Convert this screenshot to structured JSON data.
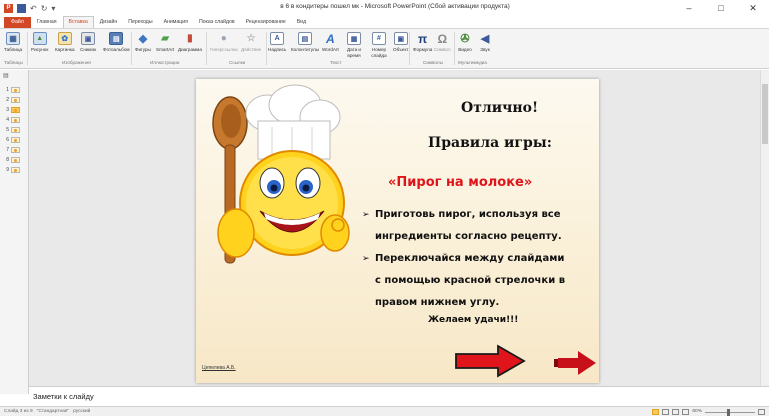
{
  "window": {
    "title": "в 6 в кондитеры пошел  мк - Microsoft PowerPoint (Сбой активации продукта)",
    "controls": [
      "–",
      "□",
      "✕"
    ]
  },
  "quick_access": {
    "app_letter": "P"
  },
  "tabs": [
    {
      "label": "Файл",
      "active": false,
      "file": true
    },
    {
      "label": "Главная",
      "active": false
    },
    {
      "label": "Вставка",
      "active": true
    },
    {
      "label": "Дизайн",
      "active": false
    },
    {
      "label": "Переходы",
      "active": false
    },
    {
      "label": "Анимация",
      "active": false
    },
    {
      "label": "Показ слайдов",
      "active": false
    },
    {
      "label": "Рецензирование",
      "active": false
    },
    {
      "label": "Вид",
      "active": false
    }
  ],
  "ribbon": {
    "buttons": {
      "table": "Таблица",
      "picture": "Рисунок",
      "clipart": "Картинка",
      "screenshot": "Снимок",
      "album": "Фотоальбом",
      "shapes": "Фигуры",
      "smartart": "SmartArt",
      "chart": "Диаграмма",
      "hyperlink": "Гиперссылка",
      "action": "Действие",
      "textbox": "Надпись",
      "header_footer": "Колонтитулы",
      "wordart": "WordArt",
      "datetime": "Дата и время",
      "slide_number": "Номер слайда",
      "object": "Объект",
      "equation": "Формула",
      "symbol": "Символ",
      "video": "Видео",
      "audio": "Звук"
    },
    "groups": {
      "tables": "Таблицы",
      "images": "Изображения",
      "illustrations": "Иллюстрации",
      "links": "Ссылки",
      "text": "Текст",
      "symbols": "Символы",
      "media": "Мультимедиа"
    }
  },
  "thumbnails": [
    {
      "num": "1",
      "selected": false
    },
    {
      "num": "2",
      "selected": false
    },
    {
      "num": "3",
      "selected": true
    },
    {
      "num": "4",
      "selected": false
    },
    {
      "num": "5",
      "selected": false
    },
    {
      "num": "6",
      "selected": false
    },
    {
      "num": "7",
      "selected": false
    },
    {
      "num": "8",
      "selected": false
    },
    {
      "num": "9",
      "selected": false
    }
  ],
  "slide": {
    "title": "Отлично!",
    "rules_heading": "Правила игры:",
    "game_name": "«Пирог на молоке»",
    "bullet_glyph": "➢",
    "bullet1_line1": "Приготовь пирог, используя все",
    "bullet1_line2": "ингредиенты согласно рецепту.",
    "bullet2_line1": "Переключайся между слайдами",
    "bullet2_line2": "с помощью красной стрелочки в",
    "bullet2_line3": "правом нижнем углу.",
    "wish": "Желаем удачи!!!",
    "author": "Цепелева А.Б.",
    "colors": {
      "accent_red": "#e0151b",
      "text": "#111111"
    }
  },
  "notes": {
    "placeholder": "Заметки к слайду"
  },
  "status": {
    "slide_info": "Слайд 3 из 9",
    "theme": "\"Стандартная\"",
    "language": "русский",
    "zoom": "60%"
  }
}
